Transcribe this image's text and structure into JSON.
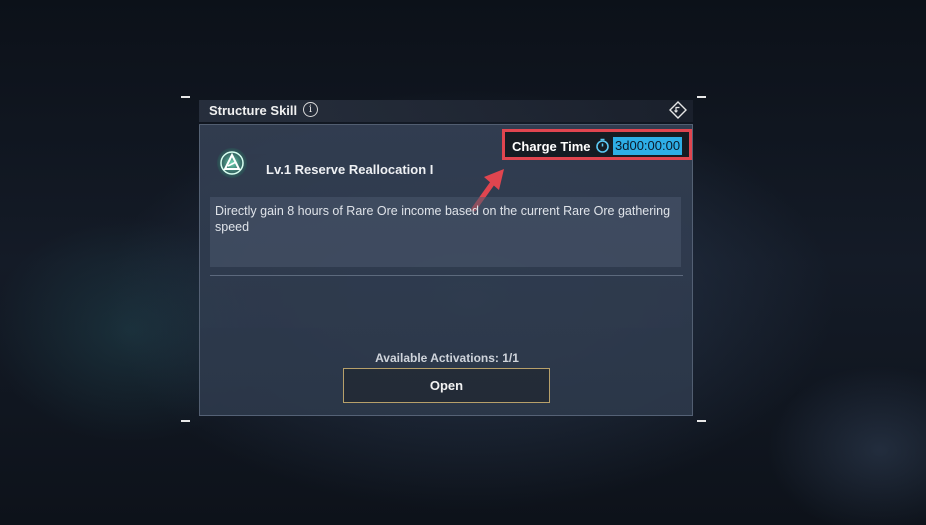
{
  "panel": {
    "title": "Structure Skill",
    "info_icon": "info-icon",
    "info_glyph": "i",
    "return_icon": "return-icon"
  },
  "skill": {
    "icon": "skill-emblem-icon",
    "name": "Lv.1 Reserve Reallocation I",
    "description": "Directly gain 8 hours of Rare Ore income based on the current Rare Ore gathering speed"
  },
  "charge": {
    "label": "Charge Time",
    "icon": "timer-icon",
    "value": "3d00:00:00"
  },
  "activations": {
    "text": "Available Activations: 1/1"
  },
  "actions": {
    "open_label": "Open"
  },
  "colors": {
    "highlight_box": "#e0454f",
    "charge_value_bg": "#2eaee6",
    "button_border": "#b7a06a",
    "arrow": "#e0454f"
  }
}
